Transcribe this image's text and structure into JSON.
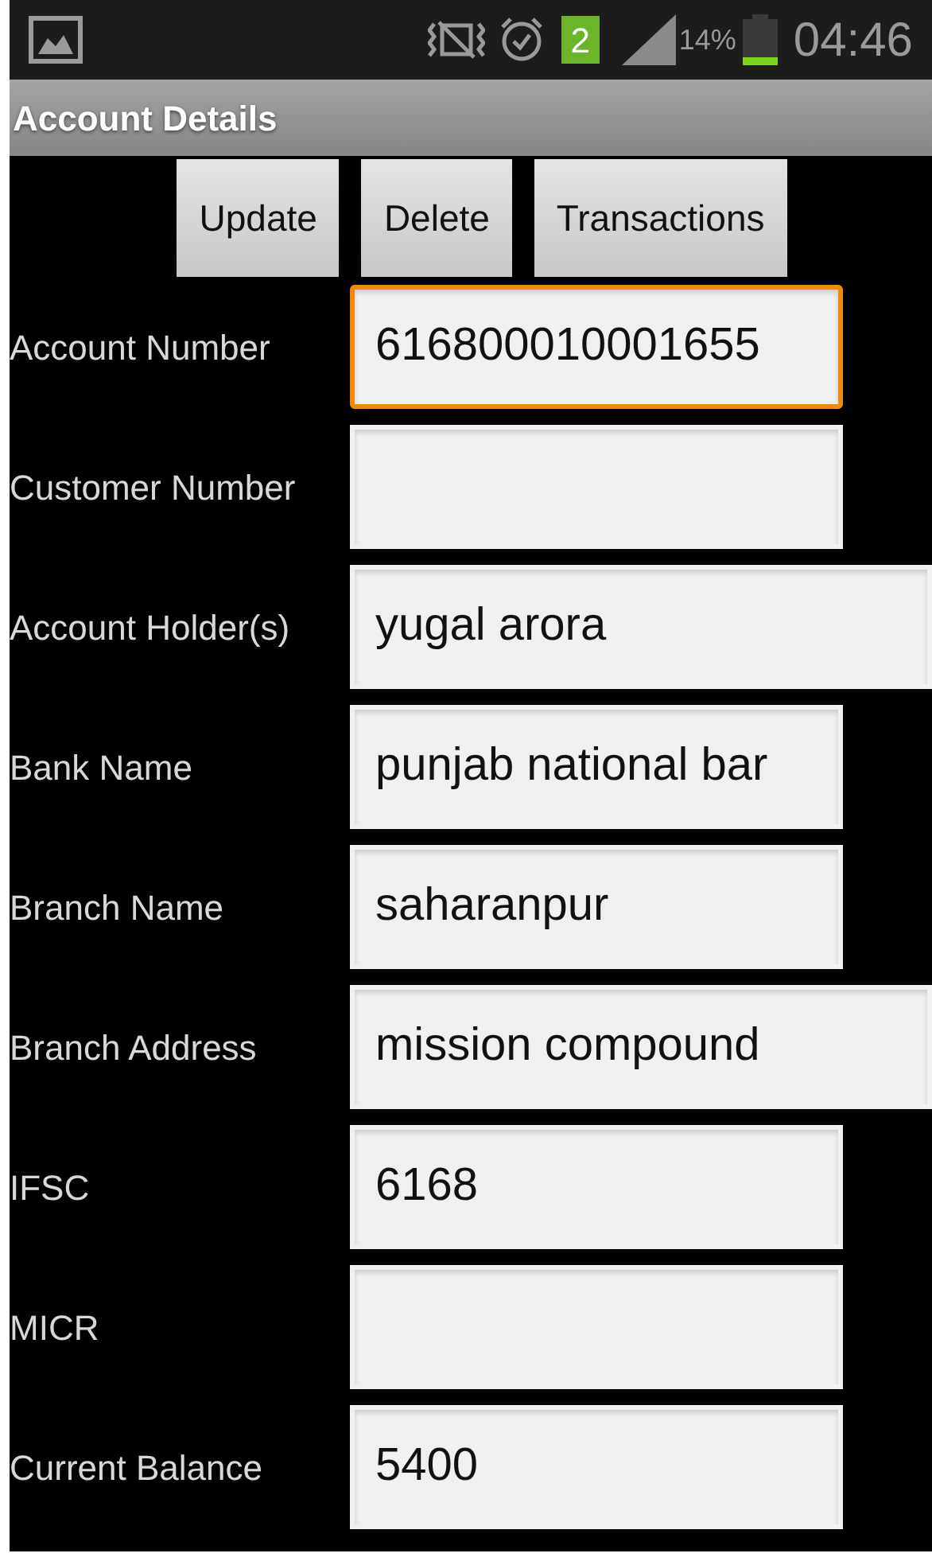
{
  "status_bar": {
    "notification_count": "2",
    "battery": "14%",
    "time": "04:46"
  },
  "title": "Account Details",
  "buttons": [
    "Update",
    "Delete",
    "Transactions"
  ],
  "fields": [
    {
      "label": "Account Number",
      "value": "616800010001655",
      "kind": "narrow",
      "focused": true
    },
    {
      "label": "Customer Number",
      "kind": "narrow",
      "focused": false
    },
    {
      "label": "Account Holder(s)",
      "value": "yugal arora",
      "kind": "wide",
      "focused": false
    },
    {
      "label": "Bank Name",
      "value": "punjab national bar",
      "kind": "narrow",
      "focused": false
    },
    {
      "label": "Branch Name",
      "value": "saharanpur",
      "kind": "narrow",
      "focused": false
    },
    {
      "label": "Branch Address",
      "value": "mission compound",
      "kind": "wide",
      "focused": false
    },
    {
      "label": "IFSC",
      "value": "6168",
      "kind": "narrow",
      "focused": false
    },
    {
      "label": "MICR",
      "kind": "narrow",
      "focused": false
    },
    {
      "label": "Current Balance",
      "value": "5400",
      "kind": "narrow",
      "focused": false
    }
  ]
}
